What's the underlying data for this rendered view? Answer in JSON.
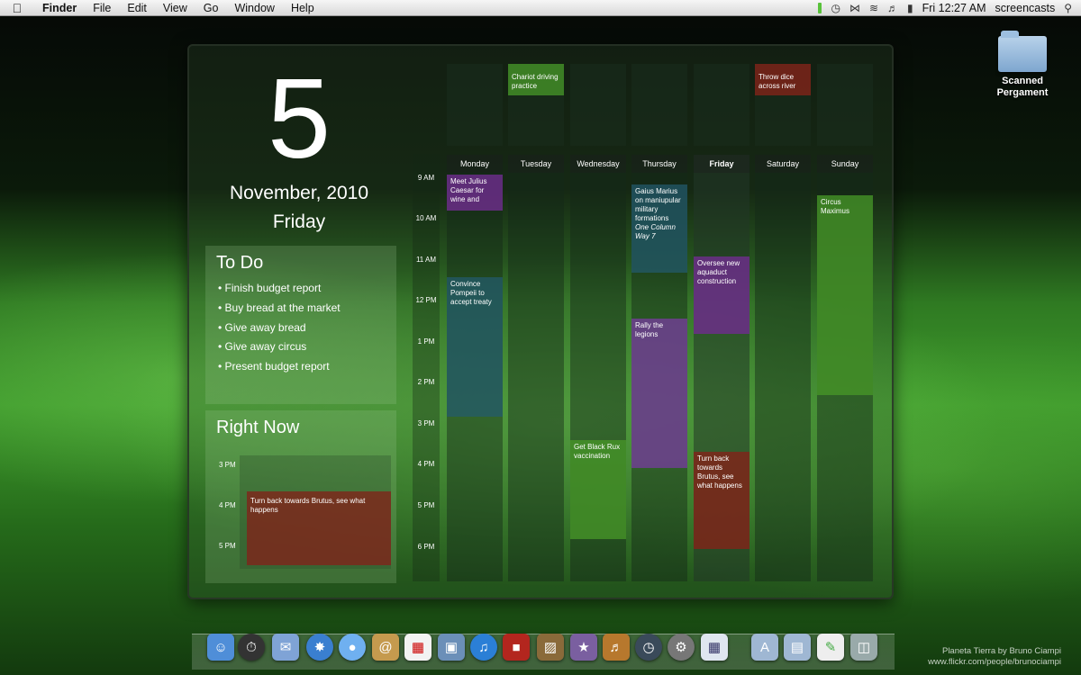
{
  "menubar": {
    "app": "Finder",
    "items": [
      "File",
      "Edit",
      "View",
      "Go",
      "Window",
      "Help"
    ],
    "clock": "Fri 12:27 AM",
    "user": "screencasts"
  },
  "desktop": {
    "icon_label": "Scanned Pergament"
  },
  "widget": {
    "day_number": "5",
    "month_year": "November, 2010",
    "weekday": "Friday",
    "todo": {
      "title": "To Do",
      "items": [
        "Finish budget report",
        "Buy bread at the market",
        "Give away bread",
        "Give away circus",
        "Present budget report"
      ]
    },
    "right_now": {
      "title": "Right Now",
      "times": [
        "3 PM",
        "4 PM",
        "5 PM"
      ],
      "event": "Turn back towards Brutus, see what happens"
    },
    "calendar": {
      "times": [
        "9 AM",
        "10 AM",
        "11 AM",
        "12 PM",
        "1 PM",
        "2 PM",
        "3 PM",
        "4 PM",
        "5 PM",
        "6 PM"
      ],
      "days": [
        "Monday",
        "Tuesday",
        "Wednesday",
        "Thursday",
        "Friday",
        "Saturday",
        "Sunday"
      ],
      "all_day": {
        "tuesday": "Chariot driving practice",
        "saturday": "Throw dice across river"
      },
      "events": {
        "mon_1": "Meet Julius Caesar for wine and",
        "mon_2": "Convince Pompeii to accept treaty",
        "wed_1": "Get Black Rux vaccination",
        "thu_1": "Gaius Marius on maniupular military formations",
        "thu_1_loc": "One Column Way 7",
        "thu_2": "Rally the legions",
        "fri_1": "Oversee new aquaduct construction",
        "fri_2": "Turn back towards Brutus, see what happens",
        "sun_1": "Circus Maximus"
      }
    }
  },
  "credit": {
    "line1": "Planeta Tierra by Bruno Ciampi",
    "line2": "www.flickr.com/people/brunociampi"
  },
  "colors": {
    "event_purple": "#6e2d8c",
    "event_teal": "#235a6e",
    "event_green": "#469628",
    "event_red": "#822319",
    "menubar_bg": "#e6e6e6"
  },
  "dock_icons": [
    "finder-icon",
    "dashboard-icon",
    "mail-stamp-icon",
    "safari-icon",
    "ichat-icon",
    "address-book-icon",
    "ical-icon",
    "iphoto-icon",
    "itunes-icon",
    "photo-booth-icon",
    "preview-icon",
    "imovie-star-icon",
    "garageband-icon",
    "time-machine-icon",
    "system-preferences-icon",
    "calendar-widget-icon",
    "applications-folder-icon",
    "documents-folder-icon",
    "downloads-stack-icon",
    "trash-icon"
  ]
}
